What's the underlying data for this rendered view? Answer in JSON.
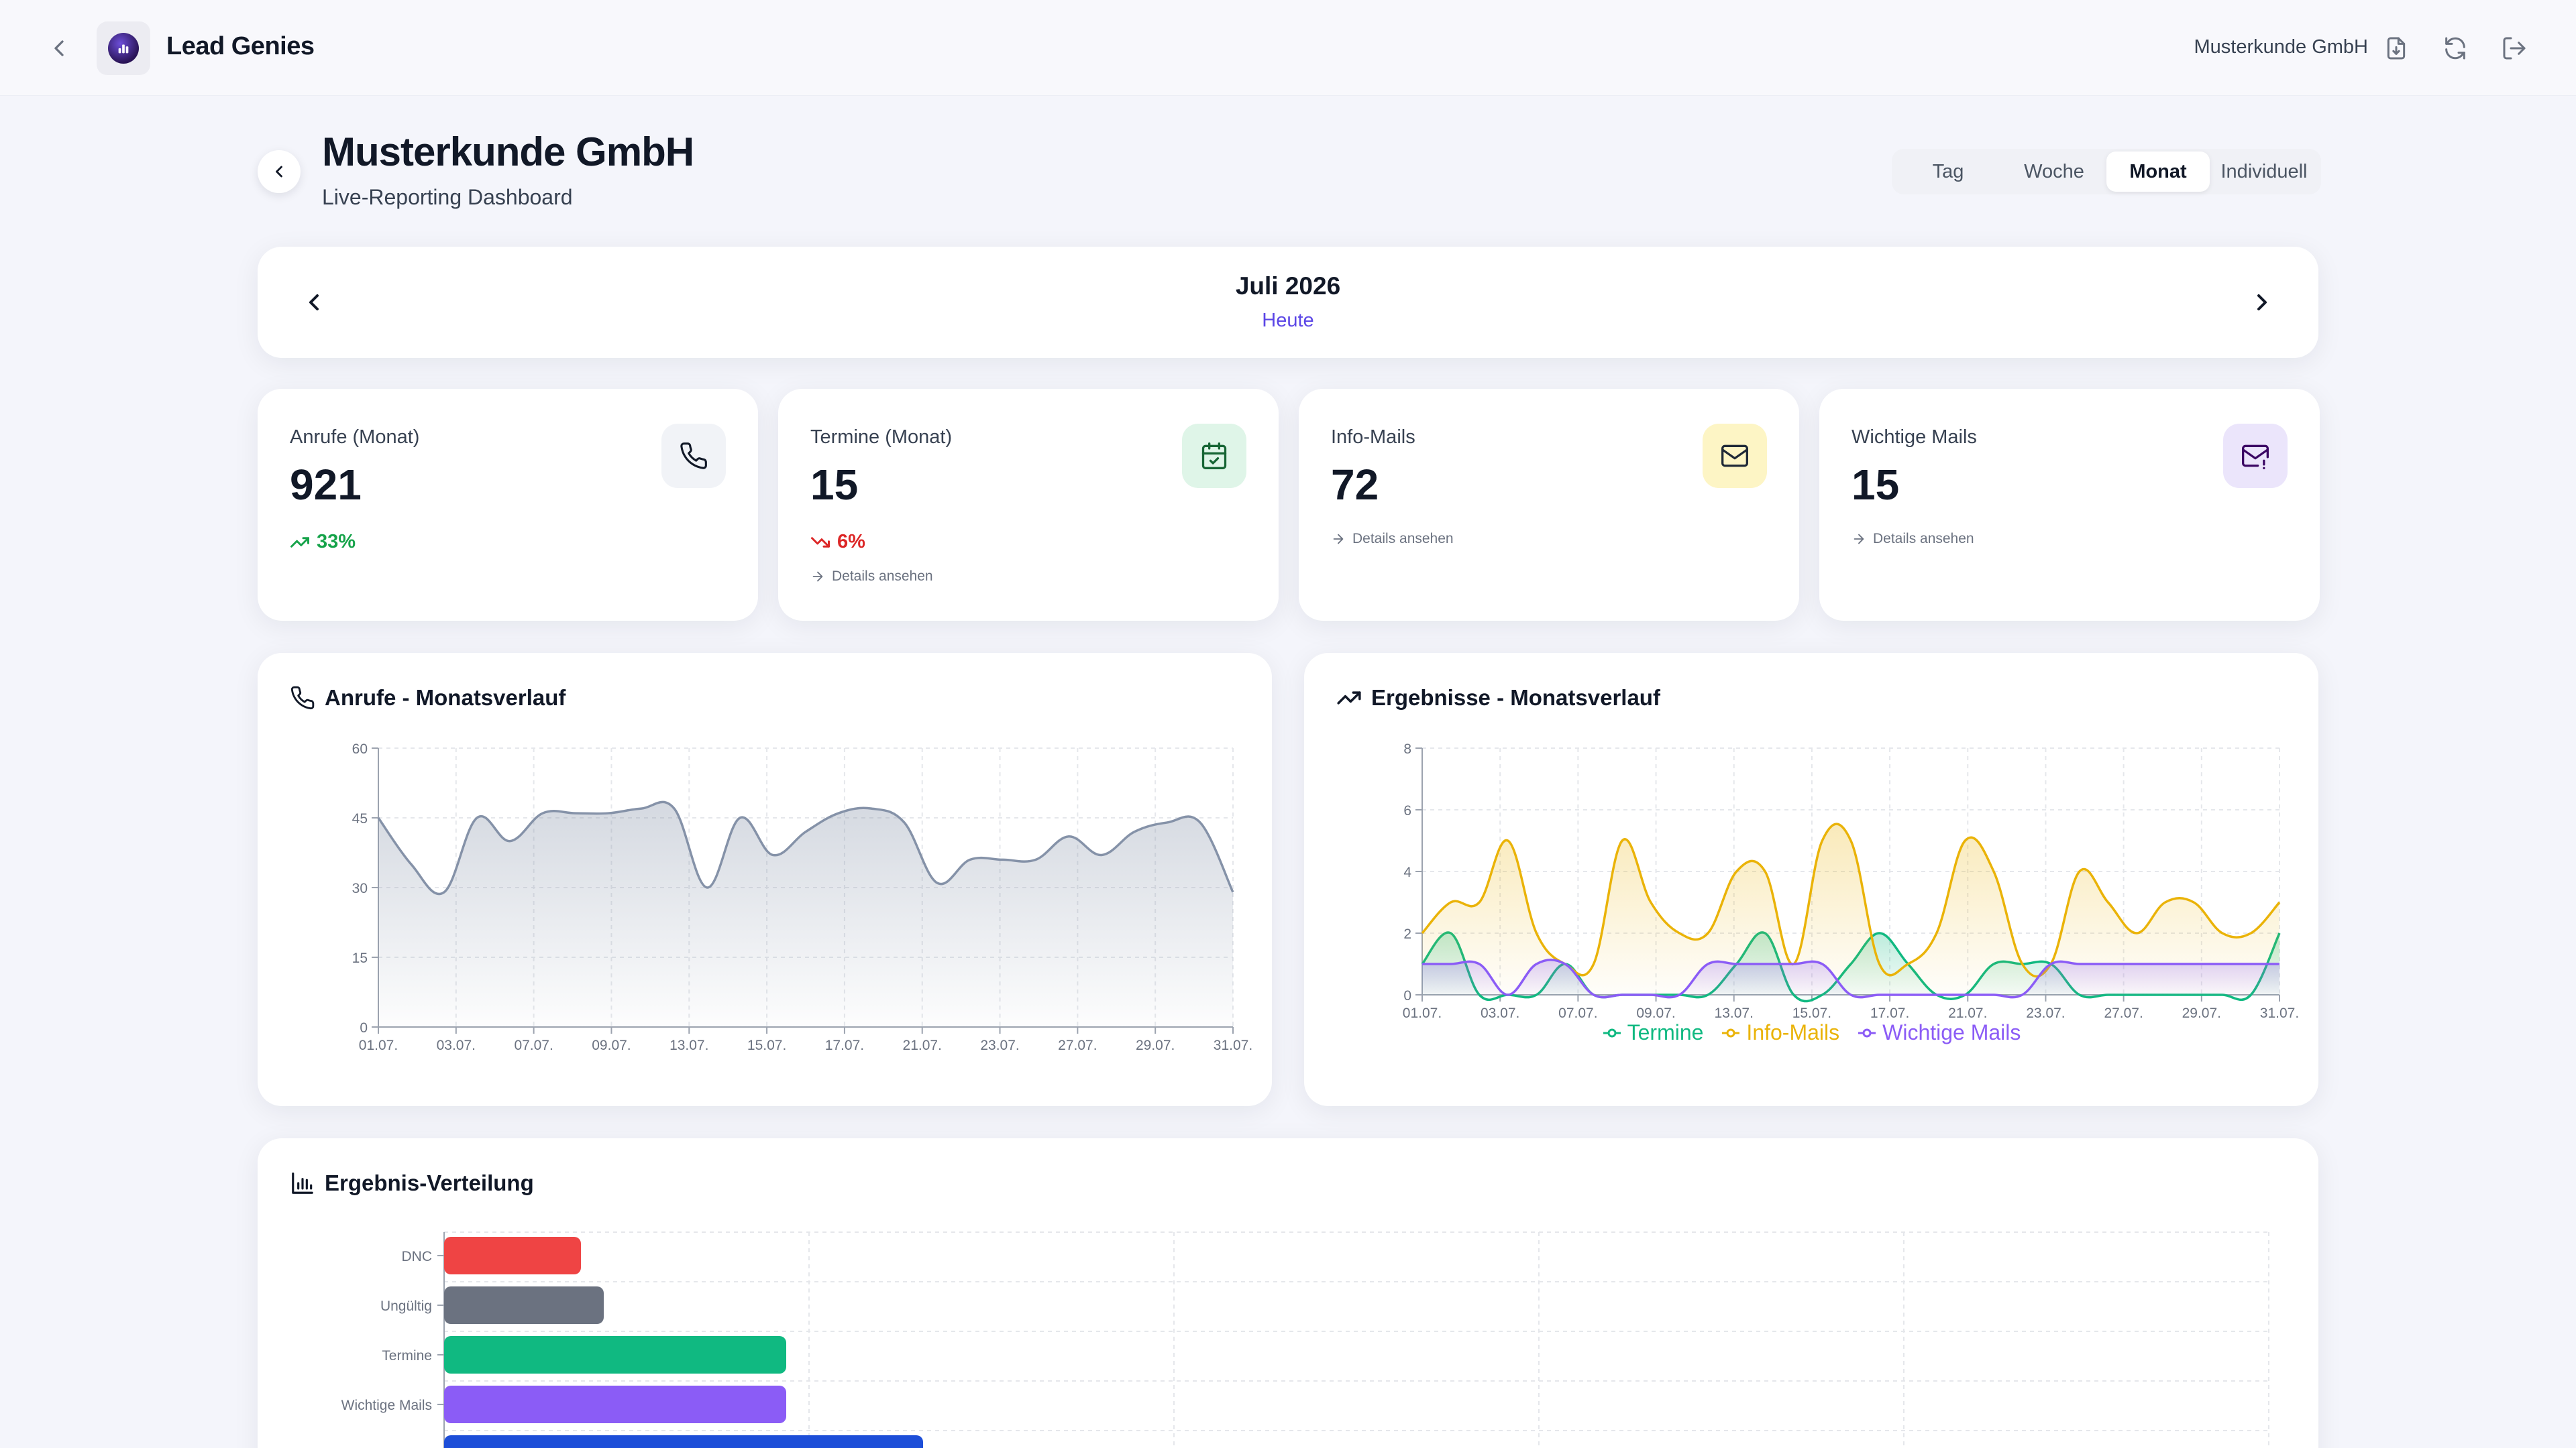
{
  "app": {
    "title": "Lead Genies",
    "client_name": "Musterkunde GmbH",
    "icons": [
      "back-icon",
      "logo-icon",
      "export-icon",
      "refresh-icon",
      "logout-icon"
    ]
  },
  "page": {
    "title": "Musterkunde GmbH",
    "subtitle": "Live-Reporting Dashboard"
  },
  "range_tabs": [
    {
      "label": "Tag",
      "active": false
    },
    {
      "label": "Woche",
      "active": false
    },
    {
      "label": "Monat",
      "active": true
    },
    {
      "label": "Individuell",
      "active": false
    }
  ],
  "period": {
    "title": "Juli 2026",
    "today_link": "Heute"
  },
  "stats": [
    {
      "label": "Anrufe (Monat)",
      "value": "921",
      "trend": "33%",
      "trend_dir": "up",
      "icon": "phone-icon",
      "icon_bg": "#f1f3f7",
      "icon_color": "#111827"
    },
    {
      "label": "Termine (Monat)",
      "value": "15",
      "trend": "6%",
      "trend_dir": "down",
      "details": "Details ansehen",
      "icon": "calendar-check-icon",
      "icon_bg": "#dff5e8",
      "icon_color": "#15803d"
    },
    {
      "label": "Info-Mails",
      "value": "72",
      "details": "Details ansehen",
      "icon": "mail-icon",
      "icon_bg": "#fdf5c5",
      "icon_color": "#1f2937"
    },
    {
      "label": "Wichtige Mails",
      "value": "15",
      "details": "Details ansehen",
      "icon": "mail-alert-icon",
      "icon_bg": "#ebe5fb",
      "icon_color": "#4c1d95"
    }
  ],
  "colors": {
    "accent": "#5b46e6",
    "up": "#16a34a",
    "down": "#dc2626",
    "termine": "#10b981",
    "info_mails": "#eab308",
    "wichtige_mails": "#8b5cf6",
    "anrufe": "#8592a8"
  },
  "charts": {
    "calls_title": "Anrufe - Monatsverlauf",
    "results_title": "Ergebnisse - Monatsverlauf",
    "distribution_title": "Ergebnis-Verteilung"
  },
  "chart_data": [
    {
      "type": "area",
      "title": "Anrufe - Monatsverlauf",
      "x": [
        "01.07.",
        "02.07.",
        "03.07.",
        "04.07.",
        "05.07.",
        "06.07.",
        "07.07.",
        "08.07.",
        "09.07.",
        "10.07.",
        "11.07.",
        "12.07.",
        "13.07.",
        "14.07.",
        "15.07.",
        "16.07.",
        "17.07.",
        "18.07.",
        "19.07.",
        "20.07.",
        "21.07.",
        "22.07.",
        "23.07.",
        "24.07.",
        "25.07.",
        "26.07.",
        "27.07.",
        "28.07.",
        "29.07.",
        "30.07.",
        "31.07."
      ],
      "x_ticks": [
        "01.07.",
        "03.07.",
        "07.07.",
        "09.07.",
        "13.07.",
        "15.07.",
        "17.07.",
        "21.07.",
        "23.07.",
        "27.07.",
        "29.07.",
        "31.07."
      ],
      "series": [
        {
          "values": [
            45,
            35,
            29,
            45,
            40,
            46,
            46,
            46,
            47,
            47,
            30,
            45,
            37,
            42,
            46,
            47,
            44,
            31,
            36,
            36,
            36,
            41,
            37,
            42,
            44,
            44,
            29
          ]
        }
      ],
      "ylim": [
        0,
        60
      ],
      "yticks": [
        0,
        15,
        30,
        45,
        60
      ],
      "grid": true
    },
    {
      "type": "line",
      "title": "Ergebnisse - Monatsverlauf",
      "x": [
        "01.07.",
        "02.07.",
        "03.07.",
        "04.07.",
        "05.07.",
        "06.07.",
        "07.07.",
        "08.07.",
        "09.07.",
        "10.07.",
        "11.07.",
        "12.07.",
        "13.07.",
        "14.07.",
        "15.07.",
        "16.07.",
        "17.07.",
        "18.07.",
        "19.07.",
        "20.07.",
        "21.07.",
        "22.07.",
        "23.07.",
        "24.07.",
        "25.07.",
        "26.07.",
        "27.07.",
        "28.07.",
        "29.07.",
        "30.07.",
        "31.07."
      ],
      "x_ticks": [
        "01.07.",
        "03.07.",
        "07.07.",
        "09.07.",
        "13.07.",
        "15.07.",
        "17.07.",
        "21.07.",
        "23.07.",
        "27.07.",
        "29.07.",
        "31.07."
      ],
      "series": [
        {
          "name": "Termine",
          "values": [
            1,
            2,
            0,
            0,
            0,
            1,
            0,
            0,
            0,
            0,
            0,
            1,
            2,
            0,
            0,
            1,
            2,
            1,
            0,
            0,
            1,
            1,
            1,
            0,
            0,
            0,
            0,
            0,
            0,
            0,
            2
          ]
        },
        {
          "name": "Info-Mails",
          "values": [
            2,
            3,
            3,
            5,
            2,
            1,
            1,
            5,
            3,
            2,
            2,
            4,
            4,
            1,
            5,
            5,
            1,
            1,
            2,
            5,
            4,
            1,
            1,
            4,
            3,
            2,
            3,
            3,
            2,
            2,
            3
          ]
        },
        {
          "name": "Wichtige Mails",
          "values": [
            1,
            1,
            1,
            0,
            1,
            1,
            0,
            0,
            0,
            0,
            1,
            1,
            1,
            1,
            1,
            0,
            0,
            0,
            0,
            0,
            0,
            0,
            1,
            1,
            1,
            1,
            1,
            1,
            1,
            1,
            1
          ]
        }
      ],
      "ylim": [
        0,
        8
      ],
      "yticks": [
        0,
        2,
        4,
        6,
        8
      ],
      "legend": "bottom",
      "grid": true
    },
    {
      "type": "bar",
      "orientation": "horizontal",
      "title": "Ergebnis-Verteilung",
      "categories": [
        "DNC",
        "Ungültig",
        "Termine",
        "Wichtige Mails",
        ""
      ],
      "values": [
        15,
        17.5,
        37.5,
        37.5,
        52.5
      ],
      "colors": [
        "#ef4444",
        "#6b7280",
        "#10b981",
        "#8b5cf6",
        "#1d4ed8"
      ],
      "xlim": [
        0,
        200
      ],
      "grid": true
    }
  ]
}
